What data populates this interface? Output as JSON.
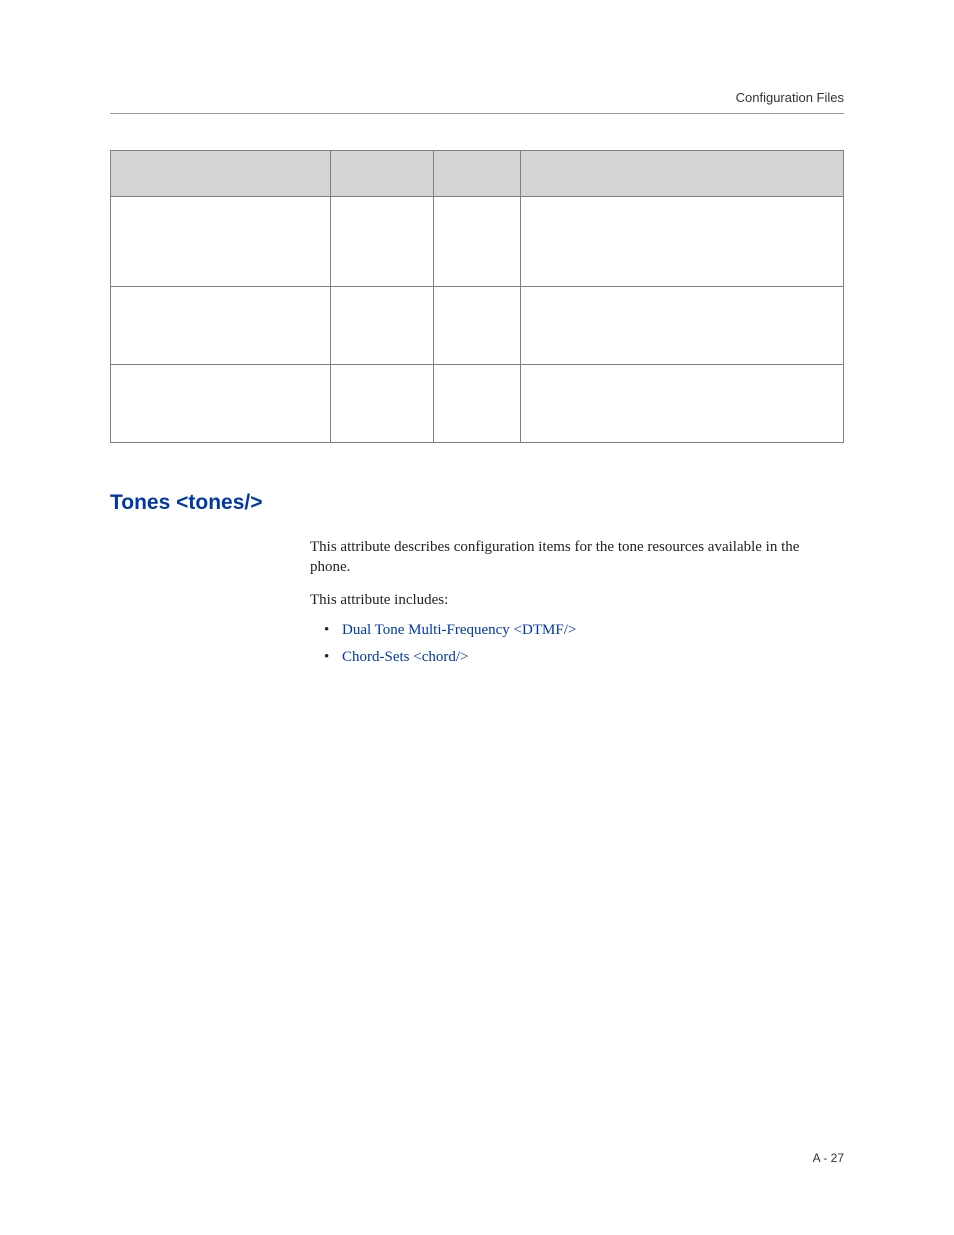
{
  "header": {
    "label": "Configuration Files"
  },
  "section": {
    "heading": "Tones <tones/>",
    "para1": "This attribute describes configuration items for the tone resources available in the phone.",
    "para2": "This attribute includes:",
    "bullets": [
      {
        "text": "Dual Tone Multi-Frequency <DTMF/>"
      },
      {
        "text": "Chord-Sets <chord/>"
      }
    ]
  },
  "footer": {
    "page": "A - 27"
  }
}
